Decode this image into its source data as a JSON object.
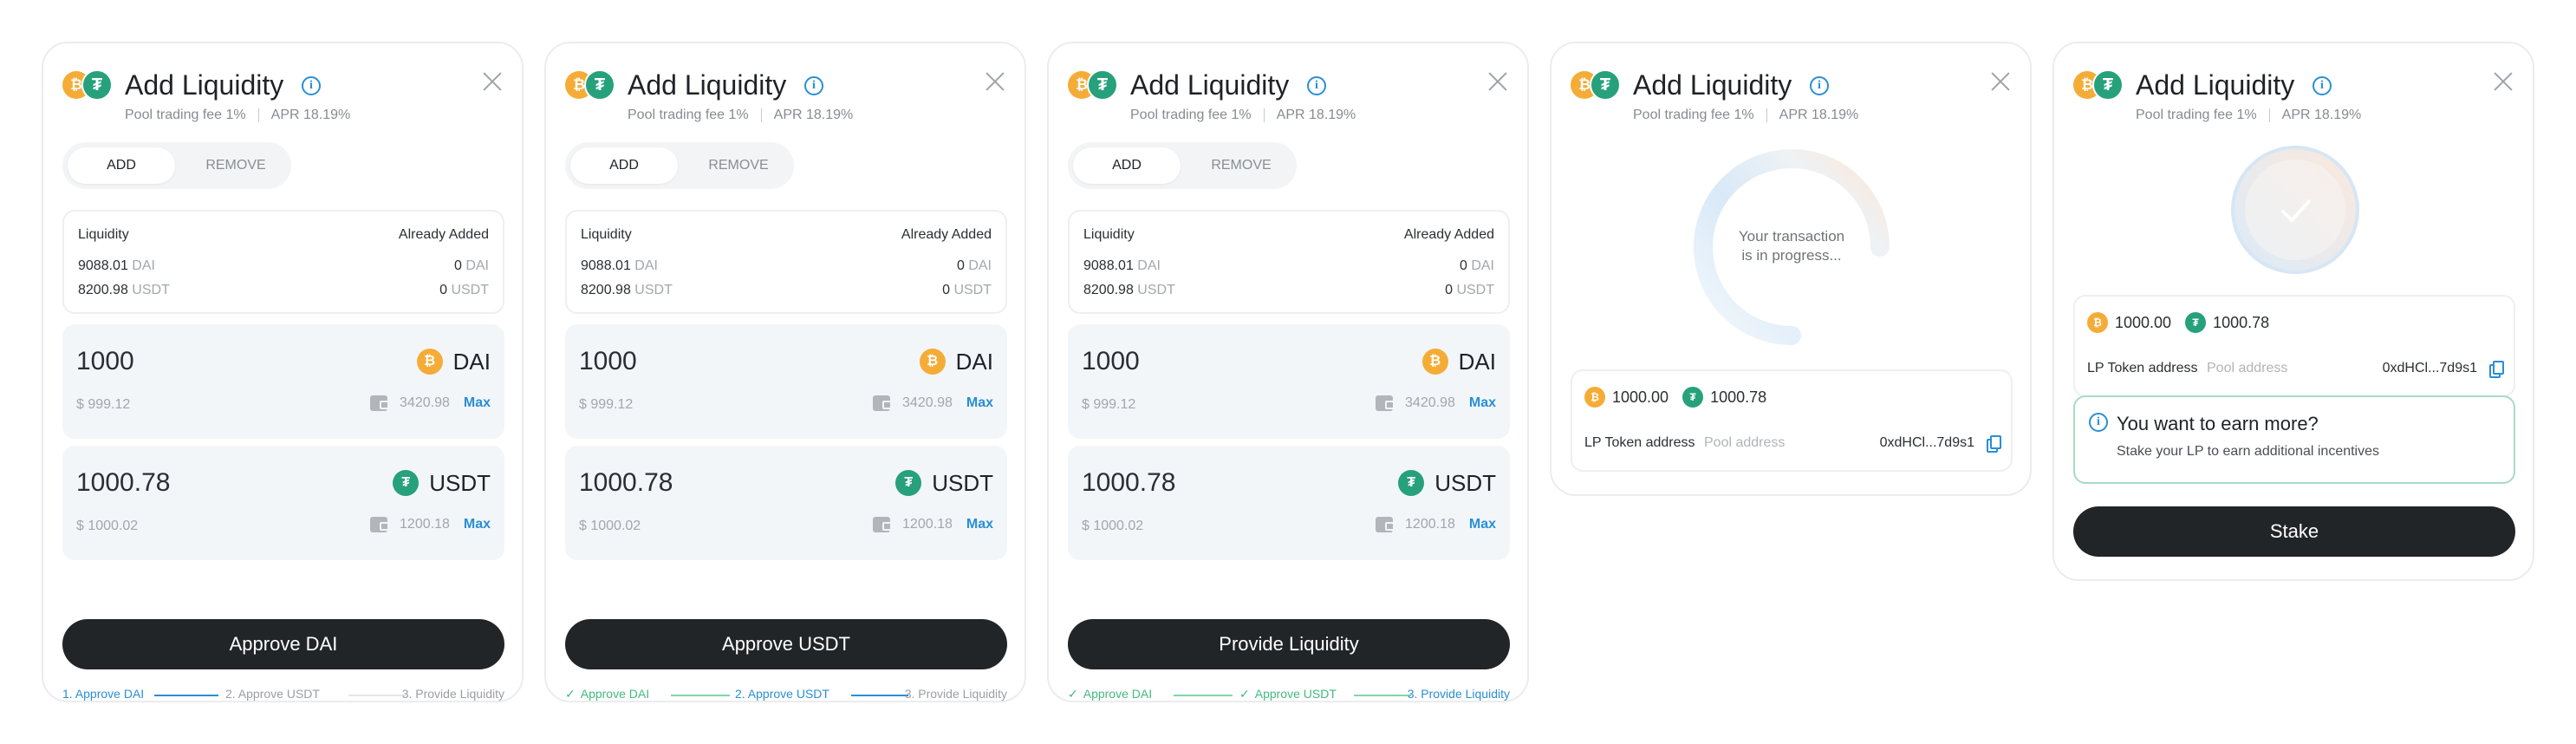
{
  "header": {
    "title": "Add Liquidity",
    "fee_text": "Pool trading fee  1%",
    "apr_text": "APR 18.19%"
  },
  "tabs": {
    "add": "ADD",
    "remove": "REMOVE"
  },
  "liquidity": {
    "label": "Liquidity",
    "added_label": "Already Added",
    "dai_amount": "9088.01",
    "dai_unit": "DAI",
    "usdt_amount": "8200.98",
    "usdt_unit": "USDT",
    "dai_added": "0",
    "usdt_added": "0"
  },
  "inputs": {
    "dai": {
      "amount": "1000",
      "usd": "$ 999.12",
      "token": "DAI",
      "balance": "3420.98"
    },
    "usdt": {
      "amount": "1000.78",
      "usd": "$ 1000.02",
      "token": "USDT",
      "balance": "1200.18"
    },
    "max_label": "Max"
  },
  "buttons": {
    "approve_dai": "Approve DAI",
    "approve_usdt": "Approve USDT",
    "provide": "Provide Liquidity",
    "stake": "Stake"
  },
  "steps": {
    "s1": "1. Approve DAI",
    "s2": "2. Approve USDT",
    "s3": "3. Provide Liquidity",
    "s1_done": "Approve DAI",
    "s2_done": "Approve USDT",
    "check": "✓"
  },
  "progress": {
    "line1": "Your transaction",
    "line2": "is in progress..."
  },
  "result": {
    "dai_amount": "1000.00",
    "usdt_amount": "1000.78",
    "lp_label": "LP Token address",
    "pool_placeholder": "Pool address",
    "address": "0xdHCl...7d9s1"
  },
  "earn": {
    "title": "You want to earn more?",
    "desc": "Stake your LP to earn additional incentives"
  },
  "icons": {
    "dai_glyph": "₿",
    "usdt_glyph": "₮",
    "info_glyph": "i",
    "dai": "dai-icon",
    "usdt": "usdt-icon",
    "info": "info-icon",
    "close": "close-icon",
    "wallet": "wallet-icon",
    "copy": "copy-icon",
    "check": "check-icon"
  },
  "colors": {
    "accent": "#2a8ed6",
    "success": "#43b97f",
    "dai": "#f5ac37",
    "usdt": "#26a17b",
    "button": "#222528"
  }
}
